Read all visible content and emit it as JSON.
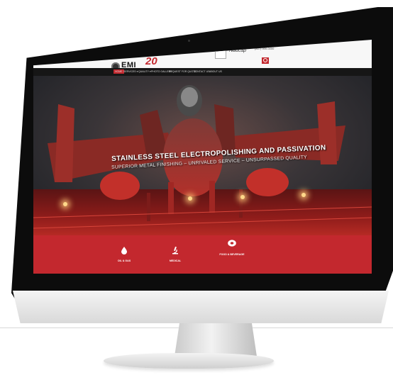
{
  "header": {
    "logo_text": "EMI",
    "logo_subtitle": "ELECTRO-MATIC",
    "anniversary": "20",
    "partner_badge": "Badge",
    "partner_script": "Nadcap",
    "phone_label": "CALL US TODAY",
    "phone_number": "(847) 000-0000"
  },
  "nav": {
    "items": [
      "HOME",
      "SERVICES ▾",
      "QUALITY ▾",
      "PHOTO GALLERY",
      "REQUEST FOR QUOTE",
      "CONTACT US",
      "ABOUT US"
    ]
  },
  "hero": {
    "headline": "STAINLESS STEEL ELECTROPOLISHING AND PASSIVATION",
    "subheadline": "SUPERIOR METAL FINISHING – UNRIVALED SERVICE – UNSURPASSED QUALITY"
  },
  "industries": [
    {
      "label": "OIL & GAS",
      "icon": "oil-drop-icon"
    },
    {
      "label": "MEDICAL",
      "icon": "microscope-icon"
    },
    {
      "label": "FOOD & BEVERAGE",
      "icon": "food-icon"
    }
  ],
  "colors": {
    "accent": "#c3282e",
    "nav_bg": "#161616",
    "header_bg": "#f7f7f7"
  }
}
